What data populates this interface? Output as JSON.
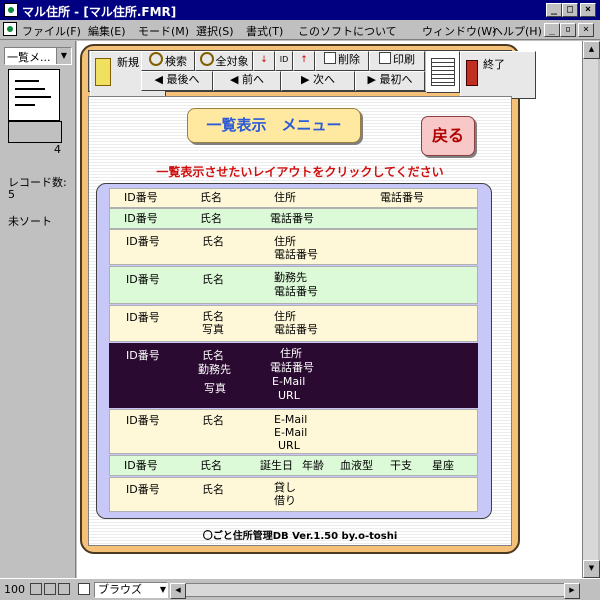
{
  "window": {
    "title": "マル住所 - [マル住所.FMR]"
  },
  "menubar": {
    "items": [
      "ファイル(F)",
      "編集(E)",
      "モード(M)",
      "選択(S)",
      "書式(T)",
      "このソフトについて",
      "ウィンドウ(W)",
      "ヘルプ(H)"
    ]
  },
  "status_pane": {
    "layout_select": "一覧メ...",
    "page_number": "4",
    "record_count_label": "レコード数:",
    "record_count": "5",
    "sort_label": "未ソート"
  },
  "toolbar": {
    "new": "新規",
    "search": "検索",
    "all_records": "全対象",
    "id": "ID",
    "delete": "削除",
    "print": "印刷",
    "end": "終了",
    "last": "最後へ",
    "prev": "前へ",
    "next": "次へ",
    "first": "最初へ"
  },
  "content": {
    "menu_title": "一覧表示　メニュー",
    "back_button": "戻る",
    "instruction": "一覧表示させたいレイアウトをクリックしてください",
    "rows": [
      {
        "id": "ID番号",
        "name": "氏名",
        "c3": "住所",
        "c4": "電話番号"
      },
      {
        "id": "ID番号",
        "name": "氏名",
        "c3": "電話番号"
      },
      {
        "id": "ID番号",
        "name": "氏名",
        "c3": "住所",
        "c3b": "電話番号"
      },
      {
        "id": "ID番号",
        "name": "氏名",
        "c3": "勤務先",
        "c3b": "電話番号"
      },
      {
        "id": "ID番号",
        "name": "氏名",
        "name2": "写真",
        "c3": "住所",
        "c3b": "電話番号"
      },
      {
        "id": "ID番号",
        "name": "氏名",
        "name2": "勤務先",
        "name3": "写真",
        "c3": "住所",
        "c3b": "電話番号",
        "c3c": "E-Mail",
        "c3d": "URL"
      },
      {
        "id": "ID番号",
        "name": "氏名",
        "c3": "E-Mail",
        "c3b": "E-Mail",
        "c3c": "URL"
      },
      {
        "id": "ID番号",
        "name": "氏名",
        "c3": "誕生日",
        "c4": "年齢",
        "c5": "血液型",
        "c6": "干支",
        "c7": "星座"
      },
      {
        "id": "ID番号",
        "name": "氏名",
        "c3": "貸し",
        "c3b": "借り"
      }
    ],
    "footer": "〇ごと住所管理DB Ver.1.50  by.o-toshi"
  },
  "statusbar": {
    "zoom": "100",
    "mode": "ブラウズ"
  },
  "colors": {
    "titlebar": "#000080",
    "frame": "#f5c078",
    "list_panel": "#c8c8f8",
    "row_cream": "#fff8d8",
    "row_green": "#dcfad8",
    "row_selected": "#2a0a30",
    "instruction": "#d01010",
    "menu_title_text": "#2a5ad8"
  }
}
